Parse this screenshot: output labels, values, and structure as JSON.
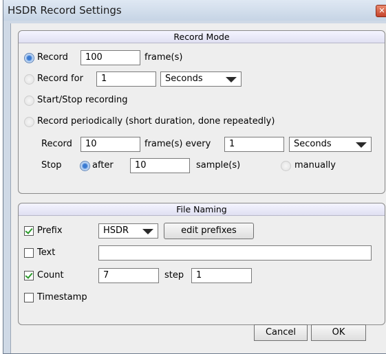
{
  "window": {
    "title": "HSDR Record Settings",
    "close_glyph": "✕"
  },
  "record_mode": {
    "header": "Record Mode",
    "record_frames": {
      "label": "Record",
      "value": "100",
      "unit": "frame(s)",
      "selected": true
    },
    "record_for": {
      "label": "Record for",
      "value": "1",
      "unit": "Seconds",
      "selected": false
    },
    "start_stop": {
      "label": "Start/Stop recording",
      "selected": false
    },
    "periodic": {
      "label": "Record periodically (short duration, done repeatedly)",
      "selected": false,
      "record_label": "Record",
      "frames_value": "10",
      "frames_every_label": "frame(s) every",
      "every_value": "1",
      "every_unit": "Seconds",
      "stop_label": "Stop",
      "after_label": "after",
      "after_value": "10",
      "samples_label": "sample(s)",
      "manually_label": "manually",
      "stop_mode": "after"
    }
  },
  "file_naming": {
    "header": "File Naming",
    "prefix": {
      "label": "Prefix",
      "checked": true,
      "value": "HSDR",
      "edit_button": "edit prefixes"
    },
    "text": {
      "label": "Text",
      "checked": false,
      "value": ""
    },
    "count": {
      "label": "Count",
      "checked": true,
      "value": "7",
      "step_label": "step",
      "step_value": "1"
    },
    "timestamp": {
      "label": "Timestamp",
      "checked": false
    }
  },
  "buttons": {
    "cancel": "Cancel",
    "ok": "OK"
  },
  "colors": {
    "title_bar": "#cfd9e6",
    "close": "#c4432b",
    "checkmark": "#2a9a2a",
    "radio_selected": "#3a7ad2"
  }
}
